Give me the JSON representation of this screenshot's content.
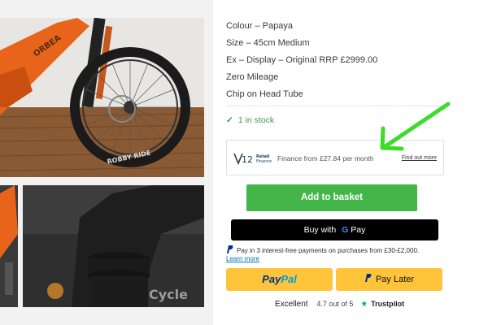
{
  "specs": [
    "Colour – Papaya",
    "Size – 45cm Medium",
    "Ex – Display – Original RRP £2999.00",
    "Zero Mileage",
    "Chip on Head Tube"
  ],
  "stock": {
    "text": "1 in stock",
    "color": "#3e9a4a"
  },
  "finance": {
    "logo_number": "12",
    "logo_line1": "Retail",
    "logo_line2": "Finance",
    "text": "Finance from £27.84 per month",
    "link": "Find out more"
  },
  "buttons": {
    "add_to_basket": "Add to basket",
    "gpay_prefix": "Buy with",
    "gpay_suffix": "Pay",
    "paypal_a": "Pay",
    "paypal_b": "Pal",
    "pay_later": "Pay Later"
  },
  "paypal_note": {
    "text": "Pay in 3 interest-free payments on purchases from £30-£2,000.",
    "learn_more": "Learn more"
  },
  "trustpilot": {
    "rating_word": "Excellent",
    "score": "4.7 out of 5",
    "brand": "Trustpilot"
  },
  "images": {
    "main_alt_brand": "ORBEA",
    "tyre_text": "ROBBY RIDE",
    "overlay_text": "Cycle"
  },
  "colors": {
    "accent_green": "#43b549",
    "paypal_yellow": "#ffc439",
    "frame_orange": "#e8641b",
    "arrow_green": "#3ddc2b"
  }
}
